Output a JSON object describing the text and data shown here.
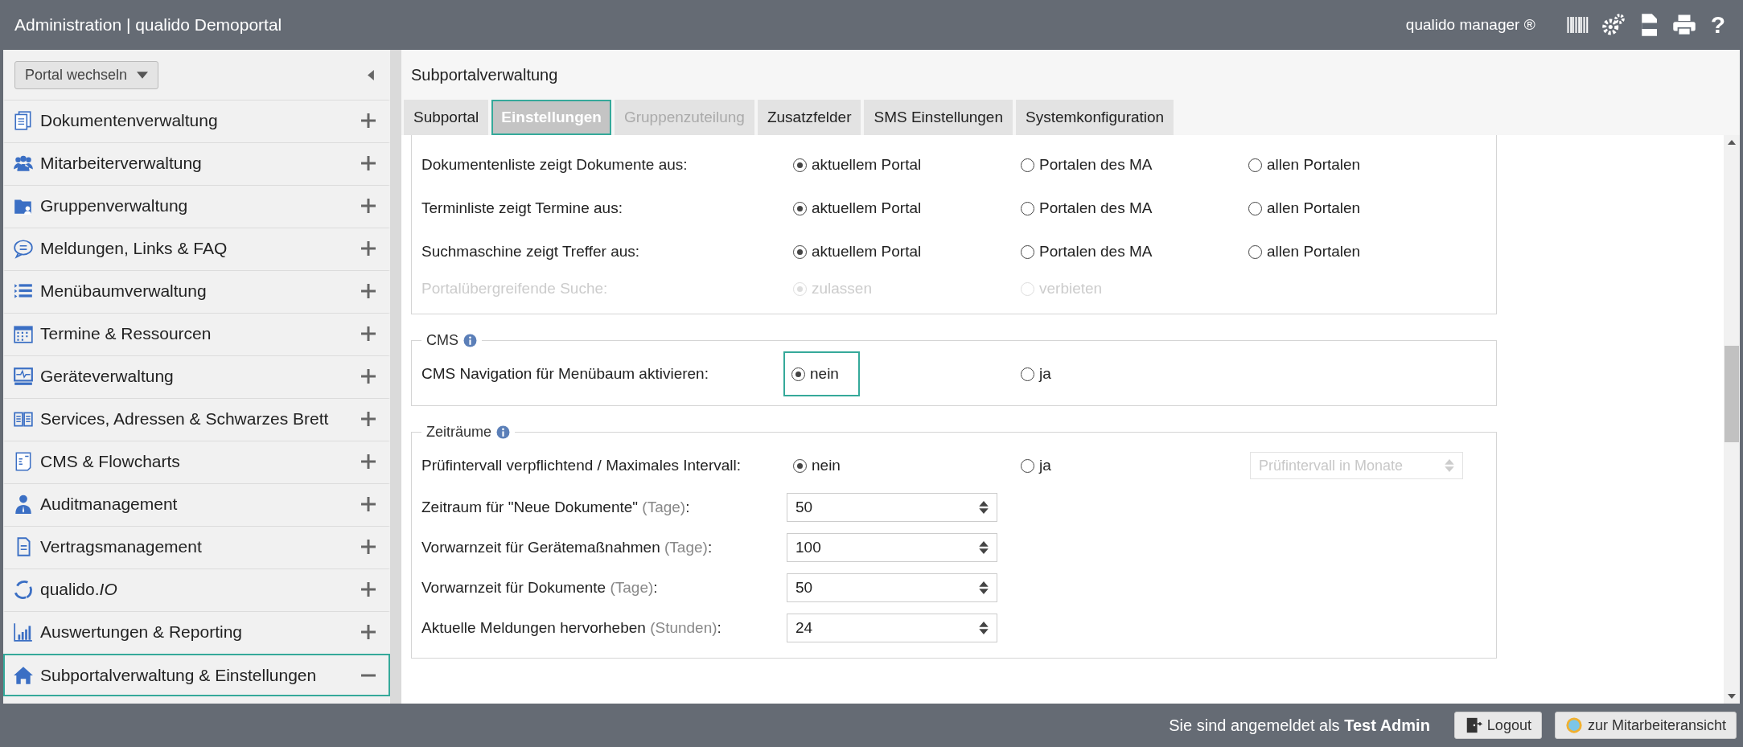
{
  "header": {
    "title": "Administration | qualido Demoportal",
    "brand": "qualido manager ®",
    "help_label": "?"
  },
  "sidebar": {
    "portal_switch": "Portal wechseln",
    "items": [
      {
        "label": "Dokumentenverwaltung",
        "selected": false,
        "expanded": false
      },
      {
        "label": "Mitarbeiterverwaltung",
        "selected": false,
        "expanded": false
      },
      {
        "label": "Gruppenverwaltung",
        "selected": false,
        "expanded": false
      },
      {
        "label": "Meldungen, Links & FAQ",
        "selected": false,
        "expanded": false
      },
      {
        "label": "Menübaumverwaltung",
        "selected": false,
        "expanded": false
      },
      {
        "label": "Termine & Ressourcen",
        "selected": false,
        "expanded": false
      },
      {
        "label": "Geräteverwaltung",
        "selected": false,
        "expanded": false
      },
      {
        "label": "Services, Adressen & Schwarzes Brett",
        "selected": false,
        "expanded": false
      },
      {
        "label": "CMS & Flowcharts",
        "selected": false,
        "expanded": false
      },
      {
        "label": "Auditmanagement",
        "selected": false,
        "expanded": false
      },
      {
        "label": "Vertragsmanagement",
        "selected": false,
        "expanded": false
      },
      {
        "label": "qualido.*IO*",
        "selected": false,
        "expanded": false
      },
      {
        "label": "Auswertungen & Reporting",
        "selected": false,
        "expanded": false
      },
      {
        "label": "Subportalverwaltung & Einstellungen",
        "selected": true,
        "expanded": true
      }
    ]
  },
  "main": {
    "title": "Subportalverwaltung",
    "tabs": [
      {
        "label": "Subportal",
        "selected": false,
        "disabled": false
      },
      {
        "label": "Einstellungen",
        "selected": true,
        "disabled": false
      },
      {
        "label": "Gruppenzuteilung",
        "selected": false,
        "disabled": true
      },
      {
        "label": "Zusatzfelder",
        "selected": false,
        "disabled": false
      },
      {
        "label": "SMS Einstellungen",
        "selected": false,
        "disabled": false
      },
      {
        "label": "Systemkonfiguration",
        "selected": false,
        "disabled": false
      }
    ],
    "sections": [
      {
        "rows": [
          {
            "kind": "radio",
            "label": "Dokumentenliste zeigt Dokumente aus:",
            "disabled": false,
            "options": [
              {
                "label": "aktuellem Portal",
                "selected": true,
                "focused": false
              },
              {
                "label": "Portalen des MA",
                "selected": false,
                "focused": false
              },
              {
                "label": "allen Portalen",
                "selected": false,
                "focused": false
              }
            ]
          },
          {
            "kind": "radio",
            "label": "Terminliste zeigt Termine aus:",
            "disabled": false,
            "options": [
              {
                "label": "aktuellem Portal",
                "selected": true,
                "focused": false
              },
              {
                "label": "Portalen des MA",
                "selected": false,
                "focused": false
              },
              {
                "label": "allen Portalen",
                "selected": false,
                "focused": false
              }
            ]
          },
          {
            "kind": "radio",
            "label": "Suchmaschine zeigt Treffer aus:",
            "disabled": false,
            "options": [
              {
                "label": "aktuellem Portal",
                "selected": true,
                "focused": false
              },
              {
                "label": "Portalen des MA",
                "selected": false,
                "focused": false
              },
              {
                "label": "allen Portalen",
                "selected": false,
                "focused": false
              }
            ]
          },
          {
            "kind": "radio",
            "label": "Portalübergreifende Suche:",
            "disabled": true,
            "options": [
              {
                "label": "zulassen",
                "selected": true,
                "focused": false
              },
              {
                "label": "verbieten",
                "selected": false,
                "focused": false
              }
            ]
          }
        ]
      },
      {
        "legend": "CMS",
        "rows": [
          {
            "kind": "radio",
            "label": "CMS Navigation für Menübaum aktivieren:",
            "disabled": false,
            "options": [
              {
                "label": "nein",
                "selected": true,
                "focused": true
              },
              {
                "label": "ja",
                "selected": false,
                "focused": false
              }
            ]
          }
        ]
      },
      {
        "legend": "Zeiträume",
        "rows": [
          {
            "kind": "radio",
            "label": "Prüfintervall verpflichtend / Maximales Intervall:",
            "disabled": false,
            "options": [
              {
                "label": "nein",
                "selected": true,
                "focused": false
              },
              {
                "label": "ja",
                "selected": false,
                "focused": false
              }
            ],
            "select": {
              "placeholder": "Prüfintervall in Monate",
              "disabled": true
            }
          },
          {
            "kind": "number",
            "label": "Zeitraum für \"Neue Dokumente\"",
            "unit": "(Tage)",
            "suffix": ":",
            "value": "50"
          },
          {
            "kind": "number",
            "label": "Vorwarnzeit für Gerätemaßnahmen",
            "unit": "(Tage)",
            "suffix": ":",
            "value": "100"
          },
          {
            "kind": "number",
            "label": "Vorwarnzeit für Dokumente",
            "unit": "(Tage)",
            "suffix": ":",
            "value": "50"
          },
          {
            "kind": "number",
            "label": "Aktuelle Meldungen hervorheben",
            "unit": "(Stunden)",
            "suffix": ":",
            "value": "24"
          }
        ]
      }
    ]
  },
  "footer": {
    "login_text": "Sie sind angemeldet als **Test Admin**",
    "logout": "Logout",
    "staff_view": "zur Mitarbeiteransicht"
  }
}
